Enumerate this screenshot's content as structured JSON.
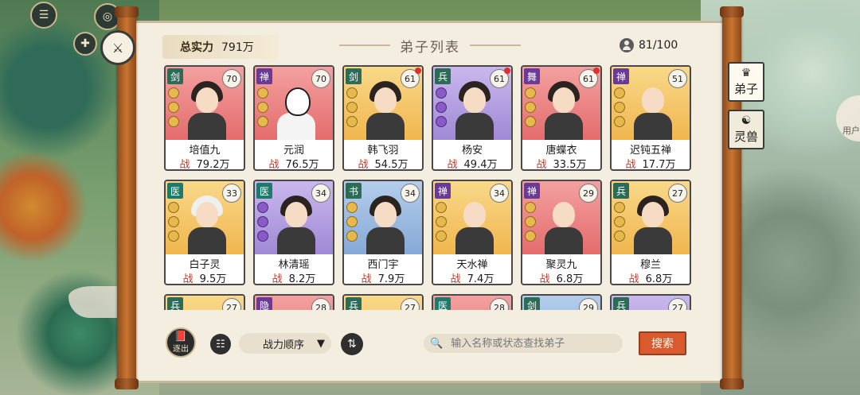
{
  "header": {
    "power_label": "总实力",
    "power_value": "791万",
    "title": "弟子列表",
    "count": "81/100"
  },
  "side_tabs": [
    {
      "label": "弟子",
      "icon": "disciple-icon"
    },
    {
      "label": "灵兽",
      "icon": "beast-icon"
    }
  ],
  "background": {
    "user_center_label": "用户"
  },
  "power_prefix": "战",
  "disciples": [
    {
      "class": "剑",
      "level": "70",
      "name": "培值九",
      "power": "79.2万",
      "bg": "red",
      "dot": false
    },
    {
      "class": "禅",
      "level": "70",
      "name": "元润",
      "power": "76.5万",
      "bg": "red",
      "dot": false
    },
    {
      "class": "剑",
      "level": "61",
      "name": "韩飞羽",
      "power": "54.5万",
      "bg": "gold",
      "dot": true
    },
    {
      "class": "兵",
      "level": "61",
      "name": "杨安",
      "power": "49.4万",
      "bg": "purple",
      "dot": true
    },
    {
      "class": "舞",
      "level": "61",
      "name": "唐蝶衣",
      "power": "33.5万",
      "bg": "red",
      "dot": true
    },
    {
      "class": "禅",
      "level": "51",
      "name": "迟钝五禅",
      "power": "17.7万",
      "bg": "gold",
      "dot": false
    },
    {
      "class": "医",
      "level": "33",
      "name": "白子灵",
      "power": "9.5万",
      "bg": "gold",
      "dot": false
    },
    {
      "class": "医",
      "level": "34",
      "name": "林清瑶",
      "power": "8.2万",
      "bg": "purple",
      "dot": false
    },
    {
      "class": "书",
      "level": "34",
      "name": "西门宇",
      "power": "7.9万",
      "bg": "blue",
      "dot": false
    },
    {
      "class": "禅",
      "level": "34",
      "name": "天水禅",
      "power": "7.4万",
      "bg": "gold",
      "dot": false
    },
    {
      "class": "禅",
      "level": "29",
      "name": "聚灵九",
      "power": "6.8万",
      "bg": "red",
      "dot": false
    },
    {
      "class": "兵",
      "level": "27",
      "name": "穆兰",
      "power": "6.8万",
      "bg": "gold",
      "dot": false
    },
    {
      "class": "兵",
      "level": "27",
      "name": "",
      "power": "",
      "bg": "gold",
      "dot": false
    },
    {
      "class": "隐",
      "level": "28",
      "name": "",
      "power": "",
      "bg": "red",
      "dot": false
    },
    {
      "class": "兵",
      "level": "27",
      "name": "",
      "power": "",
      "bg": "gold",
      "dot": false
    },
    {
      "class": "医",
      "level": "28",
      "name": "",
      "power": "",
      "bg": "red",
      "dot": false
    },
    {
      "class": "剑",
      "level": "29",
      "name": "",
      "power": "",
      "bg": "blue",
      "dot": false
    },
    {
      "class": "兵",
      "level": "27",
      "name": "",
      "power": "",
      "bg": "purple",
      "dot": false
    }
  ],
  "toolbar": {
    "exit_label": "逐出",
    "sort_label": "战力顺序",
    "search_placeholder": "输入名称或状态查找弟子",
    "search_button": "搜索"
  }
}
